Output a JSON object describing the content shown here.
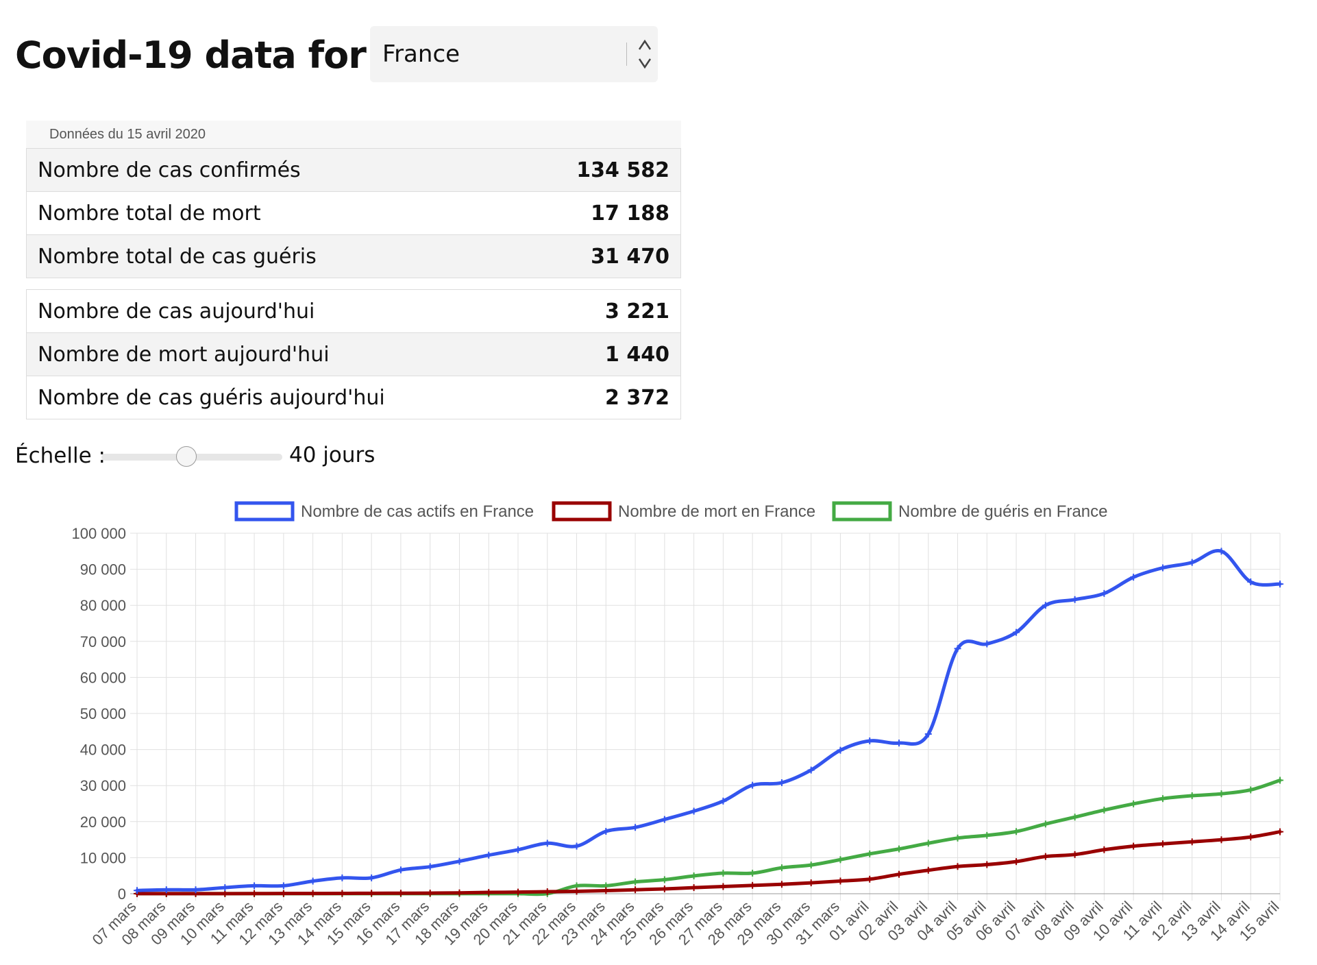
{
  "header": {
    "title": "Covid-19 data for",
    "country": "France",
    "select_arrows": "⌃⌄"
  },
  "stats": {
    "caption": "Données du 15 avril 2020",
    "totals": [
      {
        "label": "Nombre de cas confirmés",
        "value": "134 582"
      },
      {
        "label": "Nombre total de mort",
        "value": "17 188"
      },
      {
        "label": "Nombre total de cas guéris",
        "value": "31 470"
      }
    ],
    "today": [
      {
        "label": "Nombre de cas aujourd'hui",
        "value": "3 221"
      },
      {
        "label": "Nombre de mort aujourd'hui",
        "value": "1 440"
      },
      {
        "label": "Nombre de cas guéris aujourd'hui",
        "value": "2 372"
      }
    ]
  },
  "scale": {
    "label": "Échelle :",
    "value": "40 jours",
    "slider_fraction": 0.47
  },
  "chart_data": {
    "type": "line",
    "title": "",
    "xlabel": "",
    "ylabel": "",
    "ylim": [
      0,
      100000
    ],
    "y_ticks": [
      0,
      10000,
      20000,
      30000,
      40000,
      50000,
      60000,
      70000,
      80000,
      90000,
      100000
    ],
    "y_tick_labels": [
      "0",
      "10 000",
      "20 000",
      "30 000",
      "40 000",
      "50 000",
      "60 000",
      "70 000",
      "80 000",
      "90 000",
      "100 000"
    ],
    "grid": true,
    "legend_position": "top",
    "categories": [
      "07 mars",
      "08 mars",
      "09 mars",
      "10 mars",
      "11 mars",
      "12 mars",
      "13 mars",
      "14 mars",
      "15 mars",
      "16 mars",
      "17 mars",
      "18 mars",
      "19 mars",
      "20 mars",
      "21 mars",
      "22 mars",
      "23 mars",
      "24 mars",
      "25 mars",
      "26 mars",
      "27 mars",
      "28 mars",
      "29 mars",
      "30 mars",
      "31 mars",
      "01 avril",
      "02 avril",
      "03 avril",
      "04 avril",
      "05 avril",
      "06 avril",
      "07 avril",
      "08 avril",
      "09 avril",
      "10 avril",
      "11 avril",
      "12 avril",
      "13 avril",
      "14 avril",
      "15 avril"
    ],
    "series": [
      {
        "name": "Nombre de cas actifs en France",
        "color": "#3355ee",
        "values": [
          900,
          1100,
          1100,
          1700,
          2200,
          2200,
          3500,
          4400,
          4400,
          6600,
          7500,
          9000,
          10700,
          12200,
          14000,
          13200,
          17300,
          18400,
          20600,
          22900,
          25700,
          30100,
          30800,
          34300,
          39800,
          42400,
          41800,
          44300,
          68000,
          69300,
          72500,
          80000,
          81600,
          83300,
          87800,
          90400,
          91900,
          95000,
          86500,
          85900
        ]
      },
      {
        "name": "Nombre de mort en France",
        "color": "#990000",
        "values": [
          16,
          19,
          25,
          33,
          48,
          61,
          79,
          91,
          127,
          148,
          175,
          244,
          372,
          450,
          562,
          674,
          860,
          1100,
          1331,
          1696,
          1995,
          2314,
          2606,
          3024,
          3523,
          4032,
          5387,
          6507,
          7560,
          8078,
          8911,
          10328,
          10869,
          12210,
          13197,
          13832,
          14393,
          14967,
          15729,
          17188
        ]
      },
      {
        "name": "Nombre de guéris en France",
        "color": "#44aa44",
        "values": [
          12,
          12,
          12,
          12,
          12,
          12,
          12,
          12,
          12,
          12,
          12,
          12,
          12,
          12,
          12,
          2200,
          2200,
          3281,
          3900,
          4948,
          5700,
          5700,
          7202,
          7964,
          9444,
          11053,
          12428,
          14008,
          15438,
          16183,
          17250,
          19337,
          21254,
          23206,
          24932,
          26391,
          27186,
          27718,
          28805,
          31470
        ]
      }
    ]
  }
}
